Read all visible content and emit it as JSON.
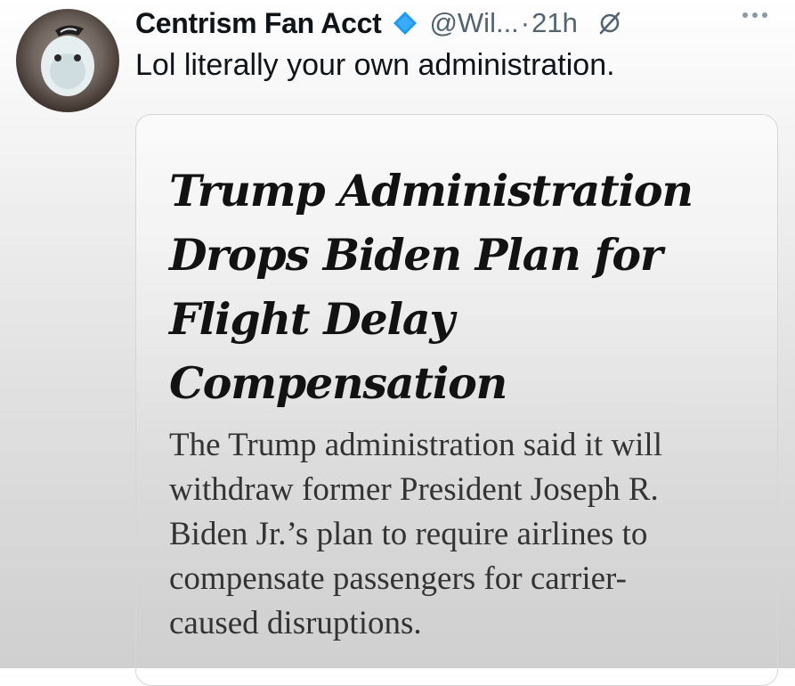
{
  "tweet": {
    "display_name": "Centrism Fan Acct",
    "handle": "@Wil...",
    "separator": "·",
    "time": "21h",
    "text": "Lol literally your own administration."
  },
  "article_card": {
    "headline_lines": [
      "Trump Administration",
      "Drops Biden Plan for",
      "Flight Delay",
      "Compensation"
    ],
    "summary_lines": [
      "The Trump administration said it will",
      "withdraw former President Joseph R.",
      "Biden Jr.’s plan to require airlines to",
      "compensate passengers for carrier-",
      "caused disruptions."
    ]
  },
  "icons": {
    "verified": "verified-badge-icon",
    "grok": "grok-icon",
    "more": "more-options-icon",
    "avatar": "avatar"
  },
  "colors": {
    "verified_blue": "#1d9bf0",
    "secondary_text": "#536471",
    "primary_text": "#0f1419"
  }
}
